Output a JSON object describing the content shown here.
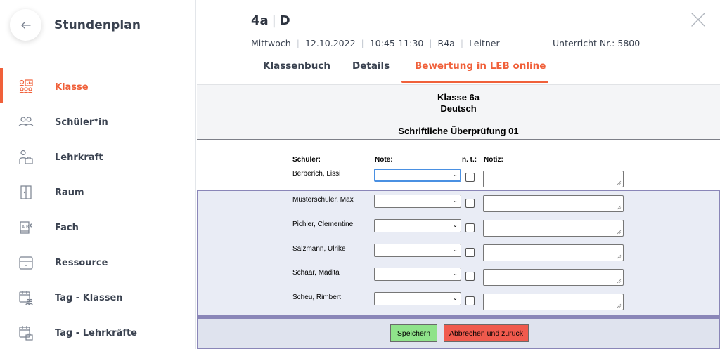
{
  "sidebar": {
    "title": "Stundenplan",
    "items": [
      {
        "label": "Klasse"
      },
      {
        "label": "Schüler*in"
      },
      {
        "label": "Lehrkraft"
      },
      {
        "label": "Raum"
      },
      {
        "label": "Fach"
      },
      {
        "label": "Ressource"
      },
      {
        "label": "Tag - Klassen"
      },
      {
        "label": "Tag - Lehrkräfte"
      }
    ]
  },
  "header": {
    "class": "4a",
    "subject": "D",
    "day": "Mittwoch",
    "date": "12.10.2022",
    "time": "10:45-11:30",
    "room": "R4a",
    "teacher": "Leitner",
    "lesson_no": "Unterricht Nr.: 5800",
    "tabs": [
      {
        "label": "Klassenbuch"
      },
      {
        "label": "Details"
      },
      {
        "label": "Bewertung in LEB online"
      }
    ]
  },
  "form": {
    "klasse": "Klasse 6a",
    "fach": "Deutsch",
    "pruefung": "Schriftliche Überprüfung 01",
    "col_student": "Schüler:",
    "col_grade": "Note:",
    "col_nt": "n. t.:",
    "col_note": "Notiz:",
    "students": [
      {
        "name": "Berberich, Lissi"
      },
      {
        "name": "Musterschüler, Max"
      },
      {
        "name": "Pichler, Clementine"
      },
      {
        "name": "Salzmann, Ulrike"
      },
      {
        "name": "Schaar, Madita"
      },
      {
        "name": "Scheu, Rimbert"
      }
    ],
    "save_label": "Speichern",
    "cancel_label": "Abbrechen und zurück"
  },
  "colors": {
    "accent": "#f0603a",
    "save": "#8fe38a",
    "cancel": "#f05a4d"
  }
}
